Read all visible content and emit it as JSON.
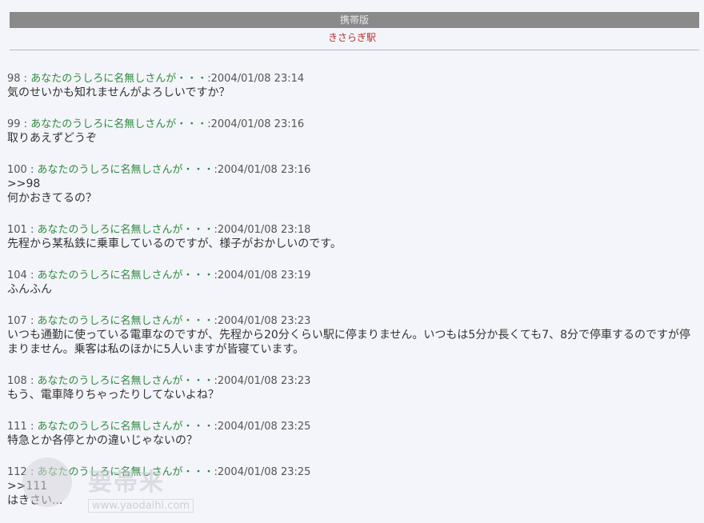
{
  "header": {
    "title": "携帯版",
    "subtitle": "きさらぎ駅"
  },
  "posts": [
    {
      "num": "98",
      "name": "あなたのうしろに名無しさんが・・・",
      "date": "2004/01/08 23:14",
      "body": "気のせいかも知れませんがよろしいですか？"
    },
    {
      "num": "99",
      "name": "あなたのうしろに名無しさんが・・・",
      "date": "2004/01/08 23:16",
      "body": "取りあえずどうぞ"
    },
    {
      "num": "100",
      "name": "あなたのうしろに名無しさんが・・・",
      "date": "2004/01/08 23:16",
      "body": ">>98\n何かおきてるの？"
    },
    {
      "num": "101",
      "name": "あなたのうしろに名無しさんが・・・",
      "date": "2004/01/08 23:18",
      "body": "先程から某私鉄に乗車しているのですが、様子がおかしいのです。"
    },
    {
      "num": "104",
      "name": "あなたのうしろに名無しさんが・・・",
      "date": "2004/01/08 23:19",
      "body": "ふんふん"
    },
    {
      "num": "107",
      "name": "あなたのうしろに名無しさんが・・・",
      "date": "2004/01/08 23:23",
      "body": "いつも通勤に使っている電車なのですが、先程から20分くらい駅に停まりません。いつもは5分か長くても7、8分で停車するのですが停まりません。乗客は私のほかに5人いますが皆寝ています。"
    },
    {
      "num": "108",
      "name": "あなたのうしろに名無しさんが・・・",
      "date": "2004/01/08 23:23",
      "body": "もう、電車降りちゃったりしてないよね？"
    },
    {
      "num": "111",
      "name": "あなたのうしろに名無しさんが・・・",
      "date": "2004/01/08 23:25",
      "body": "特急とか各停とかの違いじゃないの？"
    },
    {
      "num": "112",
      "name": "あなたのうしろに名無しさんが・・・",
      "date": "2004/01/08 23:25",
      "body": ">>111\nはきさい..."
    }
  ],
  "watermark": {
    "text": "要帯来",
    "url": "www.yaodaihi.com"
  },
  "colors": {
    "name": "#2e8b3e",
    "title_bar": "#8a8a8a",
    "subtitle": "#b03030"
  }
}
